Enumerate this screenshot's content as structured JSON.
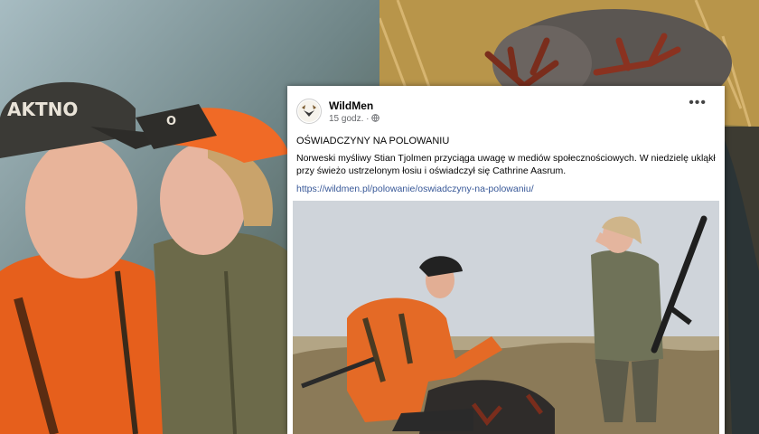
{
  "post": {
    "page_name": "WildMen",
    "time": "15 godz.",
    "privacy_icon": "globe-icon",
    "more_icon": "more-icon",
    "title": "OŚWIADCZYNY NA POLOWANIU",
    "body": "Norweski myśliwy Stian Tjolmen przyciąga uwagę w mediów społecznościowych. W niedzielę ukląkł przy świeżo ustrzelonym łosiu i oświadczył się Cathrine Aasrum.",
    "link": "https://wildmen.pl/polowanie/oswiadczyny-na-polowaniu/"
  },
  "photos": {
    "left_cap_text": "AKTNO",
    "left_cap2_text": "O"
  },
  "colors": {
    "blaze_orange": "#e8641e",
    "link_blue": "#385898"
  }
}
